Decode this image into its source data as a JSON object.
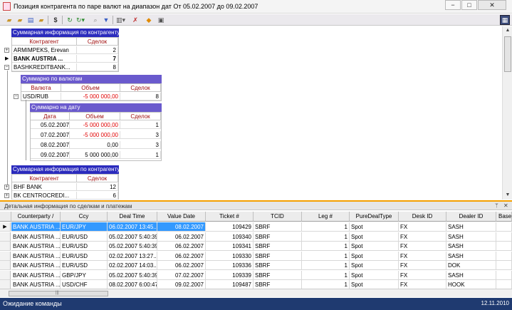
{
  "window": {
    "title": "Позиция контрагента по паре валют на диапазон дат От 05.02.2007 до 09.02.2007",
    "minimize": "−",
    "maximize": "□",
    "close": "✕"
  },
  "toolbar": {
    "icons": [
      "open-folder-icon",
      "new-folder-icon",
      "save-icon",
      "folder-icon",
      "dollar-icon",
      "refresh-icon",
      "refresh-dropdown-icon",
      "search-icon",
      "filter-icon",
      "chart-dropdown-icon",
      "delete-icon",
      "export-icon",
      "print-icon",
      "layout-icon"
    ]
  },
  "summary_counterparty": {
    "header": "Суммарная информация по контрагенту",
    "col_counterparty": "Контрагент",
    "col_deals": "Сделок",
    "rows": [
      {
        "name": "ARMIMPEKS, Erevan",
        "deals": "2",
        "expander": "+"
      },
      {
        "name": "BANK AUSTRIA ...",
        "deals": "7",
        "expander": ""
      },
      {
        "name": "BASHKREDITBANK...",
        "deals": "8",
        "expander": "−"
      }
    ]
  },
  "summary_currency": {
    "header": "Суммарно по валютам",
    "col_currency": "Валюта",
    "col_volume": "Объем",
    "col_deals": "Сделок",
    "rows": [
      {
        "currency": "USD/RUB",
        "volume": "-5 000 000,00",
        "deals": "8"
      }
    ]
  },
  "summary_date": {
    "header": "Суммарно на дату",
    "col_date": "Дата",
    "col_volume": "Объем",
    "col_deals": "Сделок",
    "rows": [
      {
        "date": "05.02.2007",
        "volume": "-5 000 000,00",
        "deals": "1"
      },
      {
        "date": "07.02.2007",
        "volume": "-5 000 000,00",
        "deals": "3"
      },
      {
        "date": "08.02.2007",
        "volume": "0,00",
        "deals": "3"
      },
      {
        "date": "09.02.2007",
        "volume": "5 000 000,00",
        "deals": "1"
      }
    ]
  },
  "summary_counterparty_2": {
    "header": "Суммарная информация по контрагенту",
    "col_counterparty": "Контрагент",
    "col_deals": "Сделок",
    "rows": [
      {
        "name": "BHF BANK",
        "deals": "12"
      },
      {
        "name": "BK CENTROCREDI...",
        "deals": "6"
      }
    ]
  },
  "detail_panel": {
    "title": "Детальная информация по сделкам и платежам",
    "pin": "ᛘ",
    "close": "✕"
  },
  "detail_grid": {
    "columns": [
      "Counterparty",
      "Ccy",
      "Deal Time",
      "Value Date",
      "Ticket #",
      "TCID",
      "Leg #",
      "PureDealType",
      "Desk ID",
      "Dealer ID",
      "Base"
    ],
    "sort_mark": "/",
    "rows": [
      [
        "BANK AUSTRIA ...",
        "EUR/JPY",
        "06.02.2007 13:45...",
        "08.02.2007",
        "109429",
        "SBRF",
        "1",
        "Spot",
        "FX",
        "SASH",
        ""
      ],
      [
        "BANK AUSTRIA ...",
        "EUR/USD",
        "05.02.2007 5:40:39",
        "06.02.2007",
        "109340",
        "SBRF",
        "1",
        "Spot",
        "FX",
        "SASH",
        ""
      ],
      [
        "BANK AUSTRIA ...",
        "EUR/USD",
        "05.02.2007 5:40:39",
        "06.02.2007",
        "109341",
        "SBRF",
        "1",
        "Spot",
        "FX",
        "SASH",
        ""
      ],
      [
        "BANK AUSTRIA ...",
        "EUR/USD",
        "02.02.2007 13:27...",
        "06.02.2007",
        "109330",
        "SBRF",
        "1",
        "Spot",
        "FX",
        "SASH",
        ""
      ],
      [
        "BANK AUSTRIA ...",
        "EUR/USD",
        "02.02.2007 14:03...",
        "06.02.2007",
        "109336",
        "SBRF",
        "1",
        "Spot",
        "FX",
        "DOK",
        ""
      ],
      [
        "BANK AUSTRIA ...",
        "GBP/JPY",
        "05.02.2007 5:40:39",
        "07.02.2007",
        "109339",
        "SBRF",
        "1",
        "Spot",
        "FX",
        "SASH",
        ""
      ],
      [
        "BANK AUSTRIA ...",
        "USD/CHF",
        "08.02.2007 6:00:47",
        "09.02.2007",
        "109487",
        "SBRF",
        "1",
        "Spot",
        "FX",
        "HOOK",
        ""
      ]
    ]
  },
  "status": {
    "text": "Ожидание команды",
    "date": "12.11.2010"
  }
}
